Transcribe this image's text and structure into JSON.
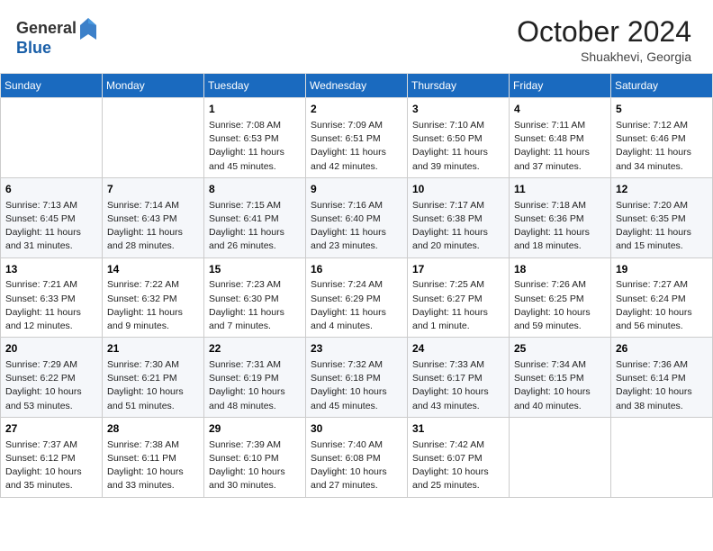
{
  "header": {
    "logo_general": "General",
    "logo_blue": "Blue",
    "month_year": "October 2024",
    "location": "Shuakhevi, Georgia"
  },
  "days_of_week": [
    "Sunday",
    "Monday",
    "Tuesday",
    "Wednesday",
    "Thursday",
    "Friday",
    "Saturday"
  ],
  "weeks": [
    [
      {
        "day": "",
        "info": ""
      },
      {
        "day": "",
        "info": ""
      },
      {
        "day": "1",
        "info": "Sunrise: 7:08 AM\nSunset: 6:53 PM\nDaylight: 11 hours and 45 minutes."
      },
      {
        "day": "2",
        "info": "Sunrise: 7:09 AM\nSunset: 6:51 PM\nDaylight: 11 hours and 42 minutes."
      },
      {
        "day": "3",
        "info": "Sunrise: 7:10 AM\nSunset: 6:50 PM\nDaylight: 11 hours and 39 minutes."
      },
      {
        "day": "4",
        "info": "Sunrise: 7:11 AM\nSunset: 6:48 PM\nDaylight: 11 hours and 37 minutes."
      },
      {
        "day": "5",
        "info": "Sunrise: 7:12 AM\nSunset: 6:46 PM\nDaylight: 11 hours and 34 minutes."
      }
    ],
    [
      {
        "day": "6",
        "info": "Sunrise: 7:13 AM\nSunset: 6:45 PM\nDaylight: 11 hours and 31 minutes."
      },
      {
        "day": "7",
        "info": "Sunrise: 7:14 AM\nSunset: 6:43 PM\nDaylight: 11 hours and 28 minutes."
      },
      {
        "day": "8",
        "info": "Sunrise: 7:15 AM\nSunset: 6:41 PM\nDaylight: 11 hours and 26 minutes."
      },
      {
        "day": "9",
        "info": "Sunrise: 7:16 AM\nSunset: 6:40 PM\nDaylight: 11 hours and 23 minutes."
      },
      {
        "day": "10",
        "info": "Sunrise: 7:17 AM\nSunset: 6:38 PM\nDaylight: 11 hours and 20 minutes."
      },
      {
        "day": "11",
        "info": "Sunrise: 7:18 AM\nSunset: 6:36 PM\nDaylight: 11 hours and 18 minutes."
      },
      {
        "day": "12",
        "info": "Sunrise: 7:20 AM\nSunset: 6:35 PM\nDaylight: 11 hours and 15 minutes."
      }
    ],
    [
      {
        "day": "13",
        "info": "Sunrise: 7:21 AM\nSunset: 6:33 PM\nDaylight: 11 hours and 12 minutes."
      },
      {
        "day": "14",
        "info": "Sunrise: 7:22 AM\nSunset: 6:32 PM\nDaylight: 11 hours and 9 minutes."
      },
      {
        "day": "15",
        "info": "Sunrise: 7:23 AM\nSunset: 6:30 PM\nDaylight: 11 hours and 7 minutes."
      },
      {
        "day": "16",
        "info": "Sunrise: 7:24 AM\nSunset: 6:29 PM\nDaylight: 11 hours and 4 minutes."
      },
      {
        "day": "17",
        "info": "Sunrise: 7:25 AM\nSunset: 6:27 PM\nDaylight: 11 hours and 1 minute."
      },
      {
        "day": "18",
        "info": "Sunrise: 7:26 AM\nSunset: 6:25 PM\nDaylight: 10 hours and 59 minutes."
      },
      {
        "day": "19",
        "info": "Sunrise: 7:27 AM\nSunset: 6:24 PM\nDaylight: 10 hours and 56 minutes."
      }
    ],
    [
      {
        "day": "20",
        "info": "Sunrise: 7:29 AM\nSunset: 6:22 PM\nDaylight: 10 hours and 53 minutes."
      },
      {
        "day": "21",
        "info": "Sunrise: 7:30 AM\nSunset: 6:21 PM\nDaylight: 10 hours and 51 minutes."
      },
      {
        "day": "22",
        "info": "Sunrise: 7:31 AM\nSunset: 6:19 PM\nDaylight: 10 hours and 48 minutes."
      },
      {
        "day": "23",
        "info": "Sunrise: 7:32 AM\nSunset: 6:18 PM\nDaylight: 10 hours and 45 minutes."
      },
      {
        "day": "24",
        "info": "Sunrise: 7:33 AM\nSunset: 6:17 PM\nDaylight: 10 hours and 43 minutes."
      },
      {
        "day": "25",
        "info": "Sunrise: 7:34 AM\nSunset: 6:15 PM\nDaylight: 10 hours and 40 minutes."
      },
      {
        "day": "26",
        "info": "Sunrise: 7:36 AM\nSunset: 6:14 PM\nDaylight: 10 hours and 38 minutes."
      }
    ],
    [
      {
        "day": "27",
        "info": "Sunrise: 7:37 AM\nSunset: 6:12 PM\nDaylight: 10 hours and 35 minutes."
      },
      {
        "day": "28",
        "info": "Sunrise: 7:38 AM\nSunset: 6:11 PM\nDaylight: 10 hours and 33 minutes."
      },
      {
        "day": "29",
        "info": "Sunrise: 7:39 AM\nSunset: 6:10 PM\nDaylight: 10 hours and 30 minutes."
      },
      {
        "day": "30",
        "info": "Sunrise: 7:40 AM\nSunset: 6:08 PM\nDaylight: 10 hours and 27 minutes."
      },
      {
        "day": "31",
        "info": "Sunrise: 7:42 AM\nSunset: 6:07 PM\nDaylight: 10 hours and 25 minutes."
      },
      {
        "day": "",
        "info": ""
      },
      {
        "day": "",
        "info": ""
      }
    ]
  ]
}
